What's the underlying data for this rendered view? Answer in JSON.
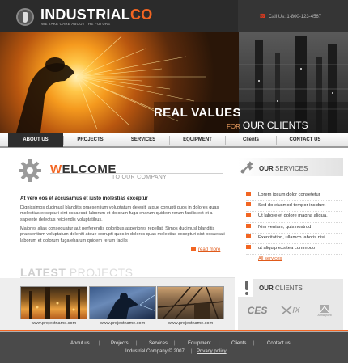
{
  "brand": {
    "name_part1": "INDUSTRIAL",
    "name_part2": "CO",
    "tagline": "WE TAKE CARE ABOUT THE FUTURE",
    "accent_color": "#f26522"
  },
  "header": {
    "phone": "Call Us: 1-800-123-4567",
    "phone_icon": "phone-icon"
  },
  "banner": {
    "line1_bold": "REAL",
    "line1_rest": "VALUES",
    "line2_small": "FOR",
    "line2_big": "OUR CLIENTS"
  },
  "nav": {
    "items": [
      {
        "label": "ABOUT US",
        "active": true
      },
      {
        "label": "PROJECTS",
        "active": false
      },
      {
        "label": "SERVICES",
        "active": false
      },
      {
        "label": "EQUIPMENT",
        "active": false
      },
      {
        "label": "Clients",
        "active": false
      },
      {
        "label": "CONTACT US",
        "active": false
      }
    ]
  },
  "welcome": {
    "title_first": "W",
    "title_rest": "ELCOME",
    "subtitle": "TO OUR COMPANY",
    "heading": "At vero eos et accusamus et iusto molestias exceptur",
    "paragraph1": "Dignissimos ducimusl blanditis praesentium voluptatum deleniti atque corrupti quos in dolores quas molestias excepturi sint occaecati laborum et dolorum fuga eharum quidem rerum facilis est et a sapiente delectus reiciendis voluptatibus.",
    "paragraph2": "Maiores alias consequatur aut perferendis doloribus asperiores repellat. Simos ducimusl blanditis praesentium voluptatum deleniti atque corrupti quos in dolores quas molestias excepturi sint occaecati laborum et dolorum fuga eharum quidem rerum facilis",
    "read_more": "read more"
  },
  "services": {
    "title_bold": "OUR",
    "title_rest": "SERVICES",
    "items": [
      "Lorem ipsum dolor consetetur",
      "Sed do eiusmod tempor incidunt",
      "Ut labore et dolore magna aliqua.",
      "Nim veniam, quis nostrud",
      "Exercitation, ullamco laboris nisi",
      "ut aliquip exsitea commodo"
    ],
    "all_link": "All services"
  },
  "latest": {
    "title_bold": "LATEST",
    "title_rest": "PROJECTS",
    "projects": [
      {
        "caption": "www.projectname.com"
      },
      {
        "caption": "www.projectname.com"
      },
      {
        "caption": "www.projectname.com"
      }
    ]
  },
  "clients": {
    "title_bold": "OUR",
    "title_rest": "CLIENTS",
    "logos": {
      "ces": "CES",
      "ix": "IX",
      "arm_name": "Armagnont"
    }
  },
  "footer": {
    "links": [
      "About us",
      "Projects",
      "Services",
      "Equipment",
      "Clients",
      "Contact us"
    ],
    "separator": "|",
    "copyright": "Industrial Company © 2007",
    "privacy": "Privacy policy"
  }
}
